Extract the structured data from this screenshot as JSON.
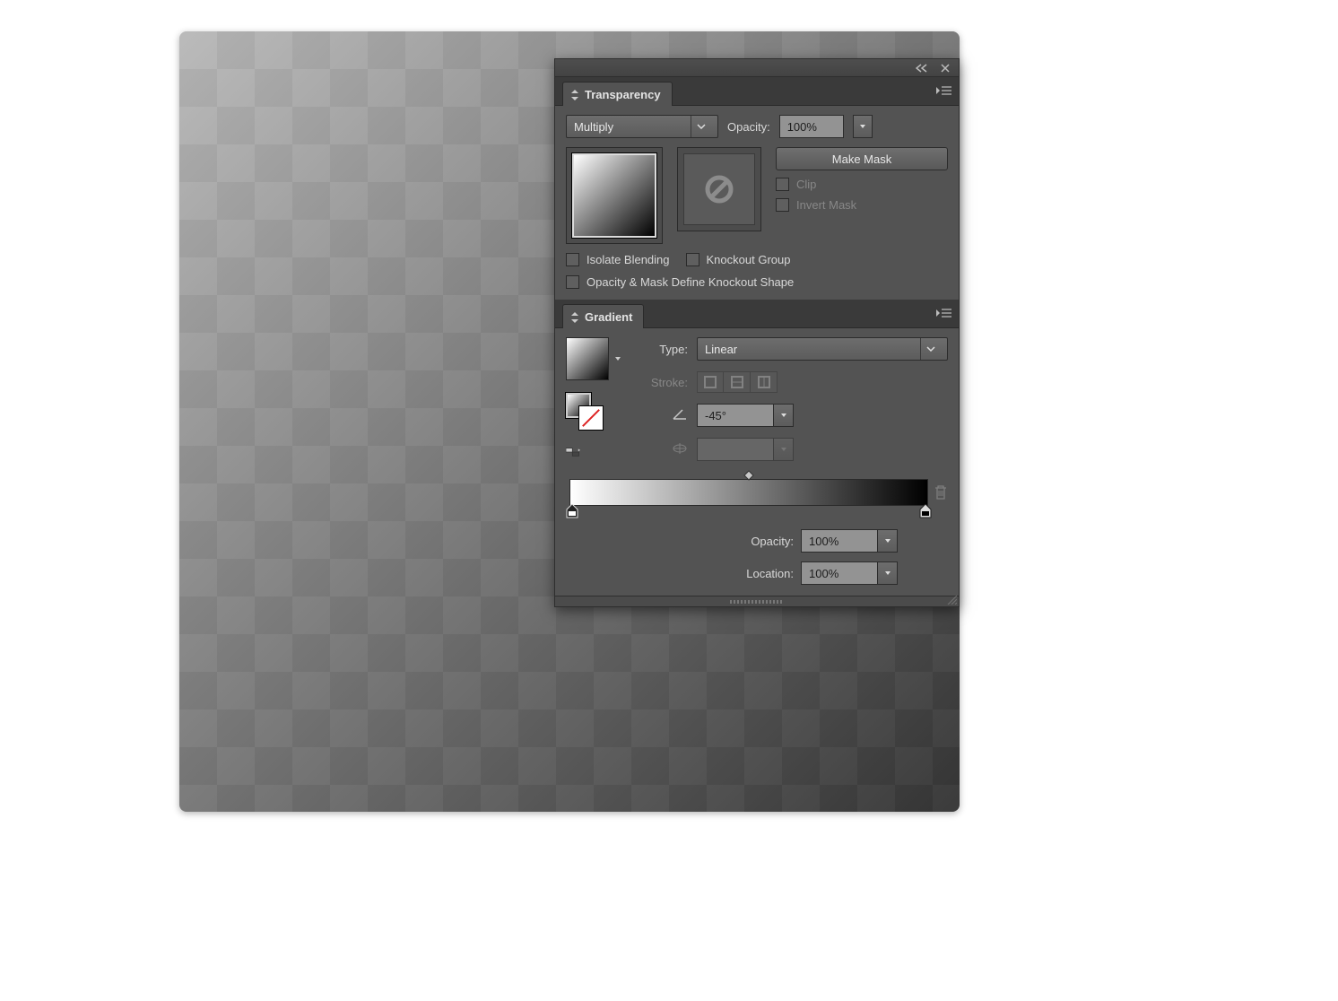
{
  "transparency": {
    "tab_label": "Transparency",
    "blend_mode": "Multiply",
    "opacity_label": "Opacity:",
    "opacity_value": "100%",
    "make_mask_label": "Make Mask",
    "clip_label": "Clip",
    "invert_mask_label": "Invert Mask",
    "isolate_label": "Isolate Blending",
    "knockout_label": "Knockout Group",
    "opacity_mask_define_label": "Opacity & Mask Define Knockout Shape"
  },
  "gradient": {
    "tab_label": "Gradient",
    "type_label": "Type:",
    "type_value": "Linear",
    "stroke_label": "Stroke:",
    "angle_value": "-45°",
    "stop_opacity_label": "Opacity:",
    "stop_opacity_value": "100%",
    "stop_location_label": "Location:",
    "stop_location_value": "100%"
  }
}
